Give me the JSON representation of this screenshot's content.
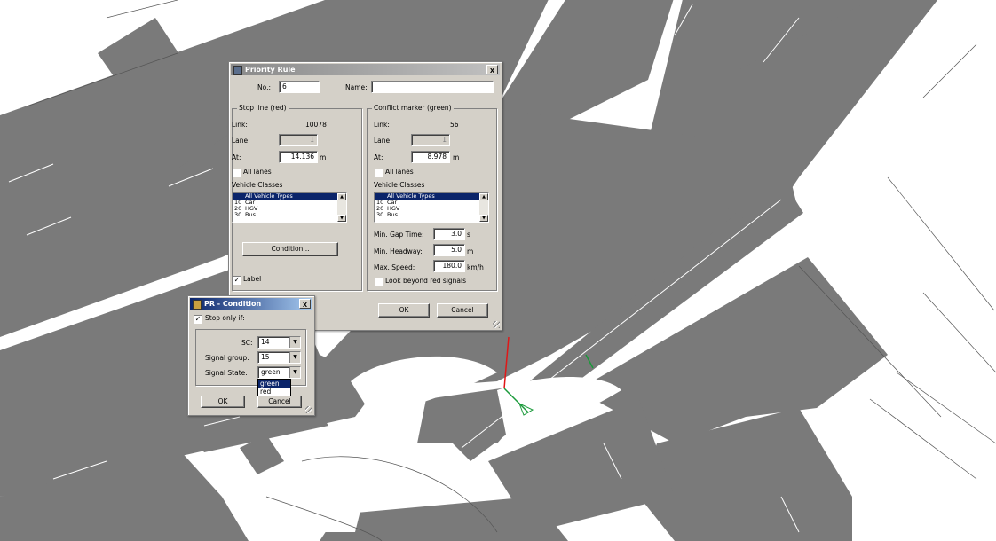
{
  "priority_rule": {
    "title": "Priority Rule",
    "no_label": "No.:",
    "no_value": "6",
    "name_label": "Name:",
    "name_value": "",
    "stop_line": {
      "group_label": "Stop line (red)",
      "link_label": "Link:",
      "link_value": "10078",
      "lane_label": "Lane:",
      "lane_value": "1",
      "at_label": "At:",
      "at_value": "14.136",
      "at_unit": "m",
      "all_lanes_label": "All lanes",
      "vehicle_classes_label": "Vehicle Classes",
      "vehicle_classes": [
        {
          "code": "",
          "name": "All Vehicle Types",
          "selected": true
        },
        {
          "code": "10",
          "name": "Car",
          "selected": false
        },
        {
          "code": "20",
          "name": "HGV",
          "selected": false
        },
        {
          "code": "30",
          "name": "Bus",
          "selected": false
        }
      ],
      "condition_button": "Condition...",
      "label_checkbox": "Label",
      "label_checked": true
    },
    "conflict_marker": {
      "group_label": "Conflict marker (green)",
      "link_label": "Link:",
      "link_value": "56",
      "lane_label": "Lane:",
      "lane_value": "1",
      "at_label": "At:",
      "at_value": "8.978",
      "at_unit": "m",
      "all_lanes_label": "All lanes",
      "vehicle_classes_label": "Vehicle Classes",
      "vehicle_classes": [
        {
          "code": "",
          "name": "All Vehicle Types",
          "selected": true
        },
        {
          "code": "10",
          "name": "Car",
          "selected": false
        },
        {
          "code": "20",
          "name": "HGV",
          "selected": false
        },
        {
          "code": "30",
          "name": "Bus",
          "selected": false
        }
      ],
      "min_gap_time_label": "Min. Gap Time:",
      "min_gap_time_value": "3.0",
      "min_gap_time_unit": "s",
      "min_headway_label": "Min. Headway:",
      "min_headway_value": "5.0",
      "min_headway_unit": "m",
      "max_speed_label": "Max. Speed:",
      "max_speed_value": "180.0",
      "max_speed_unit": "km/h",
      "look_beyond_label": "Look beyond red signals"
    },
    "ok_button": "OK",
    "cancel_button": "Cancel",
    "close_glyph": "x"
  },
  "pr_condition": {
    "title": "PR - Condition",
    "stop_only_if_label": "Stop only if:",
    "stop_only_if_checked": true,
    "sc_label": "SC:",
    "sc_value": "14",
    "signal_group_label": "Signal group:",
    "signal_group_value": "15",
    "signal_state_label": "Signal State:",
    "signal_state_value": "green",
    "signal_state_options": [
      "green",
      "red"
    ],
    "signal_state_highlighted": "green",
    "ok_button": "OK",
    "cancel_button": "Cancel",
    "close_glyph": "x"
  },
  "colors": {
    "road": "#7a7a7a",
    "background": "#ffffff",
    "stop_line": "#e01818",
    "conflict_marker": "#1a9a3a",
    "selection": "#0a246a",
    "dialog_face": "#d4d0c8"
  }
}
